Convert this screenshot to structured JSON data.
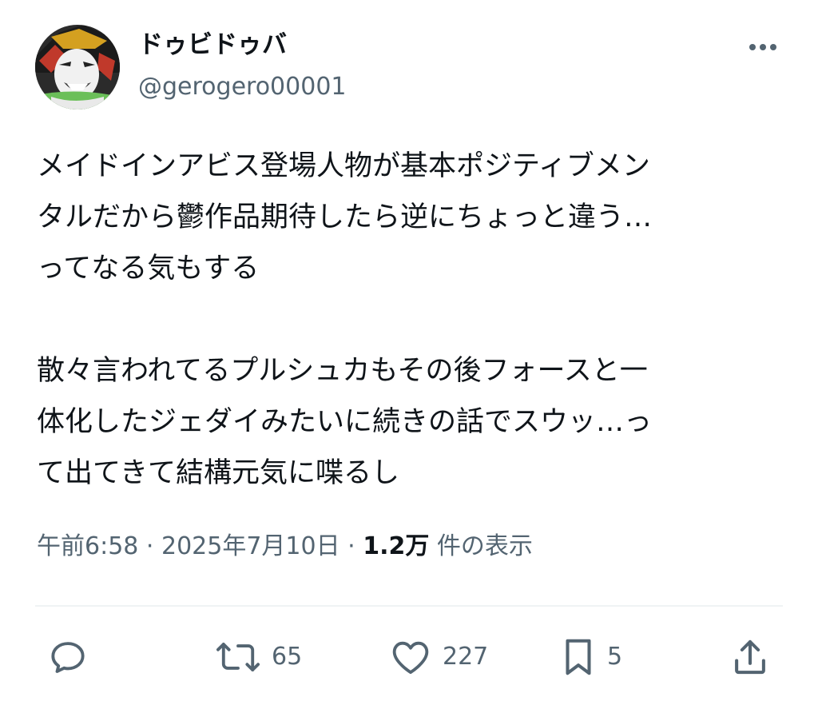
{
  "user": {
    "display_name": "ドゥビドゥバ",
    "handle": "@gerogero00001"
  },
  "post": {
    "lines": [
      "メイドインアビス登場人物が基本ポジティブメン",
      "タルだから鬱作品期待したら逆にちょっと違う…",
      "ってなる気もする",
      "",
      "散々言われてるプルシュカもその後フォースと一",
      "体化したジェダイみたいに続きの話でスウッ…っ",
      "て出てきて結構元気に喋るし"
    ]
  },
  "meta": {
    "time": "午前6:58",
    "sep1": " · ",
    "date": "2025年7月10日",
    "sep2": " · ",
    "views_count": "1.2万",
    "views_label": " 件の表示"
  },
  "actions": {
    "reply_count": "",
    "retweet_count": "65",
    "like_count": "227",
    "bookmark_count": "5"
  },
  "icons": {
    "more": "more-horizontal-icon",
    "reply": "reply-icon",
    "retweet": "retweet-icon",
    "like": "heart-icon",
    "bookmark": "bookmark-icon",
    "share": "share-icon"
  },
  "colors": {
    "text": "#0f1419",
    "secondary": "#536471",
    "divider": "#eff3f4"
  }
}
